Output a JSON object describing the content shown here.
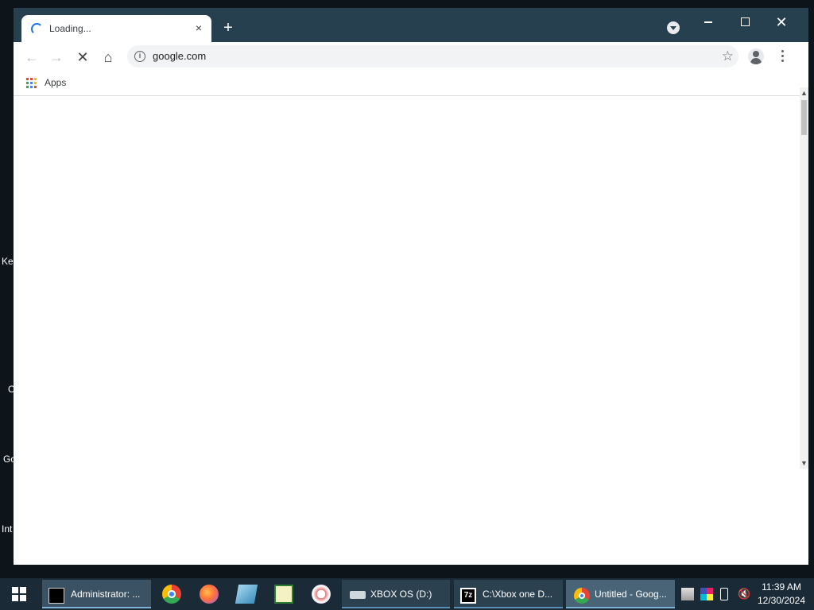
{
  "desktop": {
    "labels": [
      "Ke",
      "C",
      "Gc",
      "Int"
    ]
  },
  "browser": {
    "tab": {
      "title": "Loading...",
      "close": "×"
    },
    "newtab": "+",
    "window_controls": {
      "close": "✕"
    },
    "toolbar": {
      "back": "←",
      "forward": "→",
      "stop": "✕",
      "home": "⌂",
      "info": "i",
      "url": "google.com",
      "star": "☆"
    },
    "bookmarks": {
      "apps_label": "Apps"
    },
    "colors": {
      "titlebar": "#26404f",
      "accent": "#1a73e8"
    }
  },
  "taskbar": {
    "items": [
      {
        "label": "Administrator: ...",
        "icon": "cmd-icon"
      },
      {
        "label": "XBOX OS (D:)",
        "icon": "drive-icon"
      },
      {
        "label": "C:\\Xbox one D...",
        "icon": "7zip-icon"
      },
      {
        "label": "Untitled - Goog...",
        "icon": "chrome-icon"
      }
    ],
    "pinned": [
      "chrome-icon",
      "firefox-icon",
      "notepad-icon",
      "archive-icon",
      "paint-icon"
    ],
    "sevenzip_text": "7z",
    "clock": {
      "time": "11:39 AM",
      "date": "12/30/2024"
    }
  }
}
